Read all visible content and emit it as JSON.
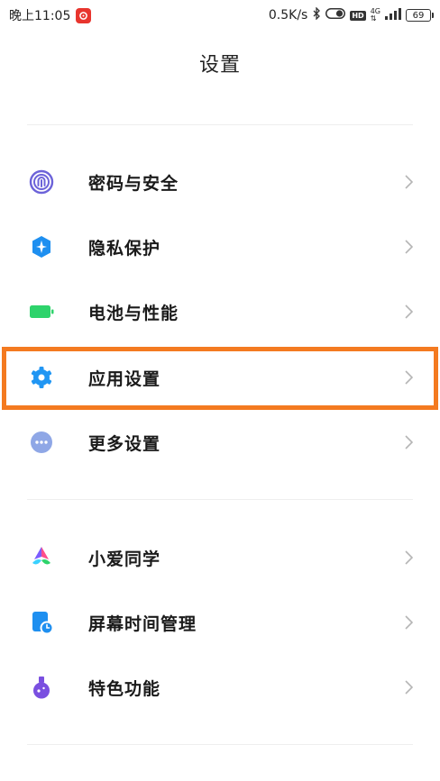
{
  "status_bar": {
    "time": "晚上11:05",
    "network_speed": "0.5K/s",
    "hd_label": "HD",
    "network_type": "4G",
    "battery_level": "69"
  },
  "header": {
    "title": "设置"
  },
  "menu": {
    "group1": [
      {
        "label": "密码与安全",
        "icon": "fingerprint-icon"
      },
      {
        "label": "隐私保护",
        "icon": "privacy-shield-icon"
      },
      {
        "label": "电池与性能",
        "icon": "battery-icon"
      },
      {
        "label": "应用设置",
        "icon": "gear-icon"
      },
      {
        "label": "更多设置",
        "icon": "more-dots-icon"
      }
    ],
    "group2": [
      {
        "label": "小爱同学",
        "icon": "xiaoai-icon"
      },
      {
        "label": "屏幕时间管理",
        "icon": "screen-time-icon"
      },
      {
        "label": "特色功能",
        "icon": "flask-icon"
      }
    ]
  },
  "colors": {
    "highlight": "#f47a20",
    "fingerprint": "#6c63d9",
    "privacy": "#1e8ff0",
    "battery": "#2ed36b",
    "gear": "#2196f3",
    "more": "#8fa7e6",
    "flask": "#7a4fe0"
  }
}
